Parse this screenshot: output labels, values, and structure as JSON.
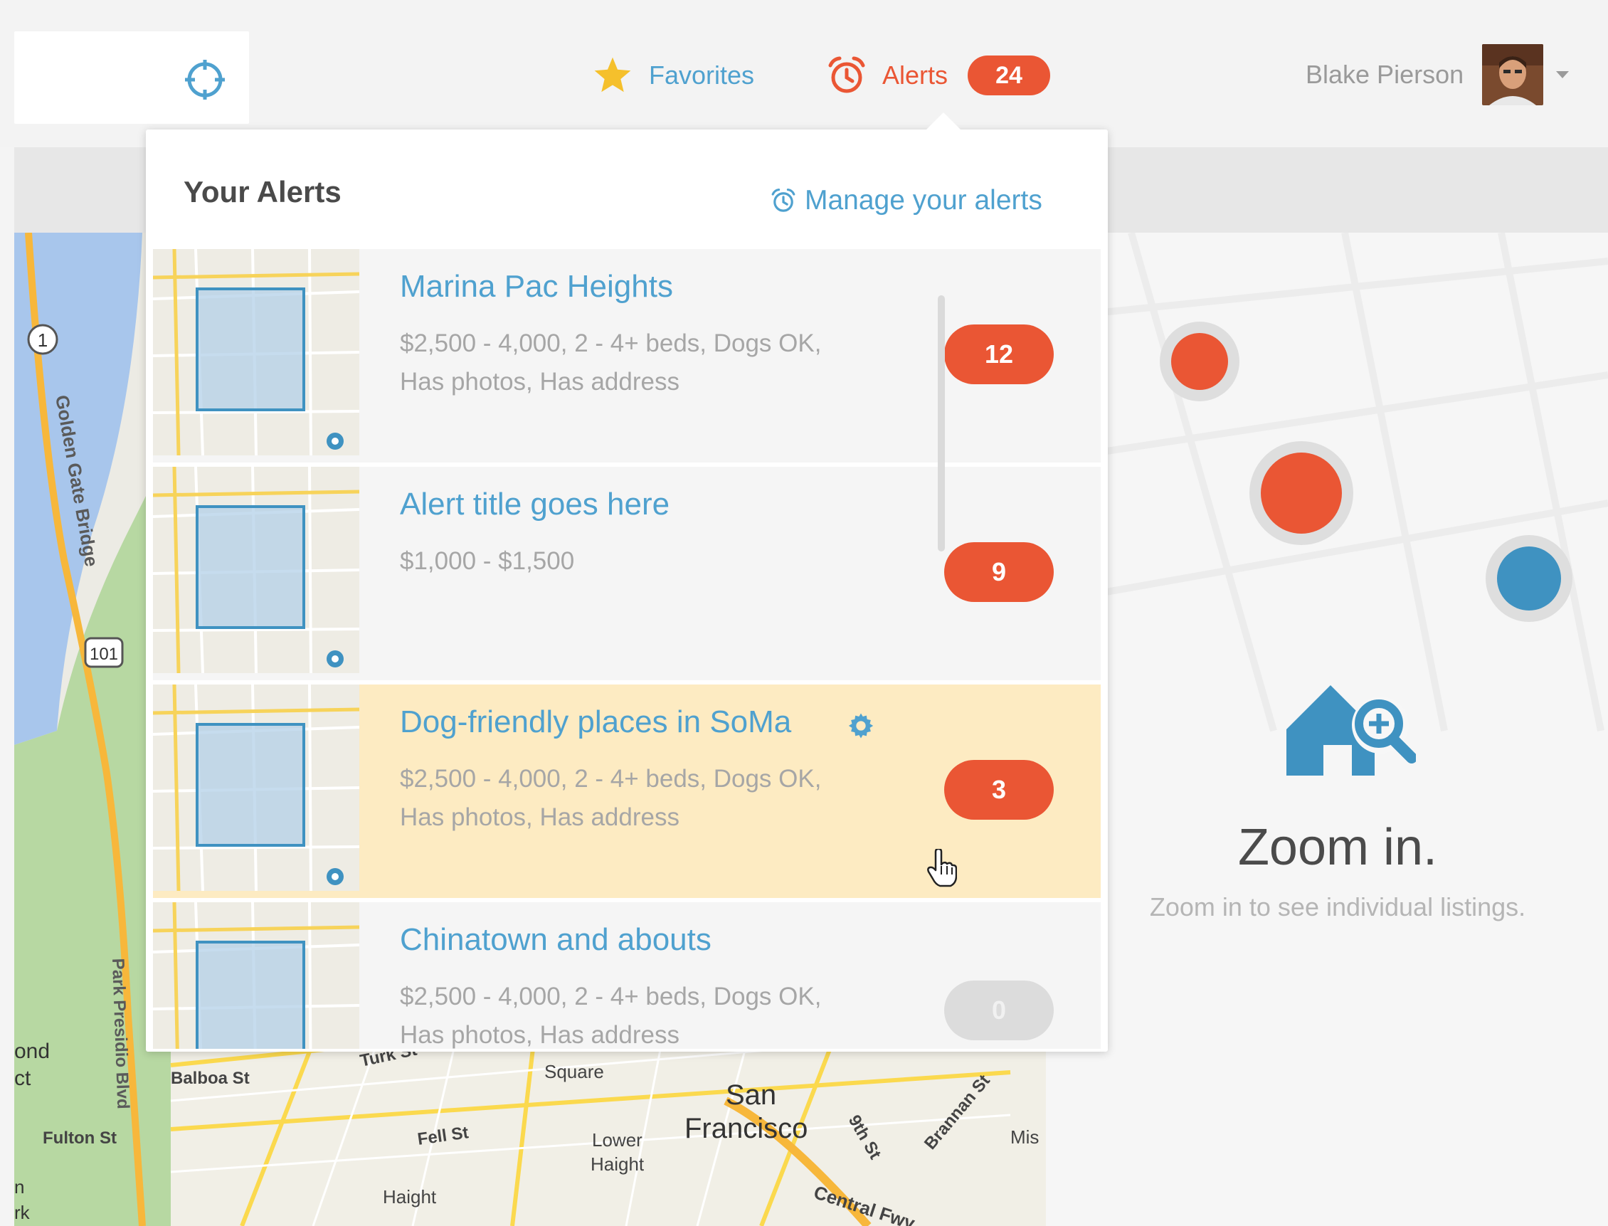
{
  "header": {
    "favorites_label": "Favorites",
    "alerts_label": "Alerts",
    "alerts_count": "24",
    "user_name": "Blake Pierson"
  },
  "alerts_dropdown": {
    "title": "Your Alerts",
    "manage_label": "Manage your alerts",
    "items": [
      {
        "title": "Marina Pac Heights",
        "line1": "$2,500 - 4,000, 2 - 4+ beds, Dogs OK,",
        "line2": "Has photos, Has address",
        "count": "12"
      },
      {
        "title": "Alert title goes here",
        "line1": "$1,000 - $1,500",
        "line2": "",
        "count": "9"
      },
      {
        "title": "Dog-friendly places in SoMa",
        "line1": "$2,500 - 4,000, 2 - 4+ beds, Dogs OK,",
        "line2": "Has photos, Has address",
        "count": "3"
      },
      {
        "title": "Chinatown and abouts",
        "line1": "$2,500 - 4,000, 2 - 4+ beds, Dogs OK,",
        "line2": "Has photos, Has address",
        "count": "0"
      }
    ]
  },
  "map_labels": {
    "golden_gate": "Golden Gate Bridge",
    "park_presidio": "Park Presidio Blvd",
    "balboa": "Balboa St",
    "fulton": "Fulton St",
    "turk": "Turk St",
    "fell": "Fell St",
    "square": "Square",
    "san_francisco_1": "San",
    "san_francisco_2": "Francisco",
    "lower_haight_1": "Lower",
    "lower_haight_2": "Haight",
    "haight": "Haight",
    "brannan": "Brannan St",
    "ninth": "9th St",
    "central": "Central Fwy",
    "mis": "Mis",
    "ond": "ond",
    "ct": "ct",
    "n": "n",
    "rk": "rk",
    "route_1": "1",
    "route_101": "101"
  },
  "empty_state": {
    "title": "Zoom in.",
    "subtitle": "Zoom in to see individual listings."
  },
  "icons": {
    "locate": "crosshair-icon",
    "favorites": "star-icon",
    "alerts": "alarm-clock-icon",
    "manage": "alarm-clock-icon",
    "settings": "gear-icon",
    "zoom": "house-magnifier-icon"
  },
  "colors": {
    "accent_blue": "#4fa1cf",
    "accent_orange": "#ea5634",
    "highlight": "#fdebc2",
    "star": "#f5c02c"
  }
}
